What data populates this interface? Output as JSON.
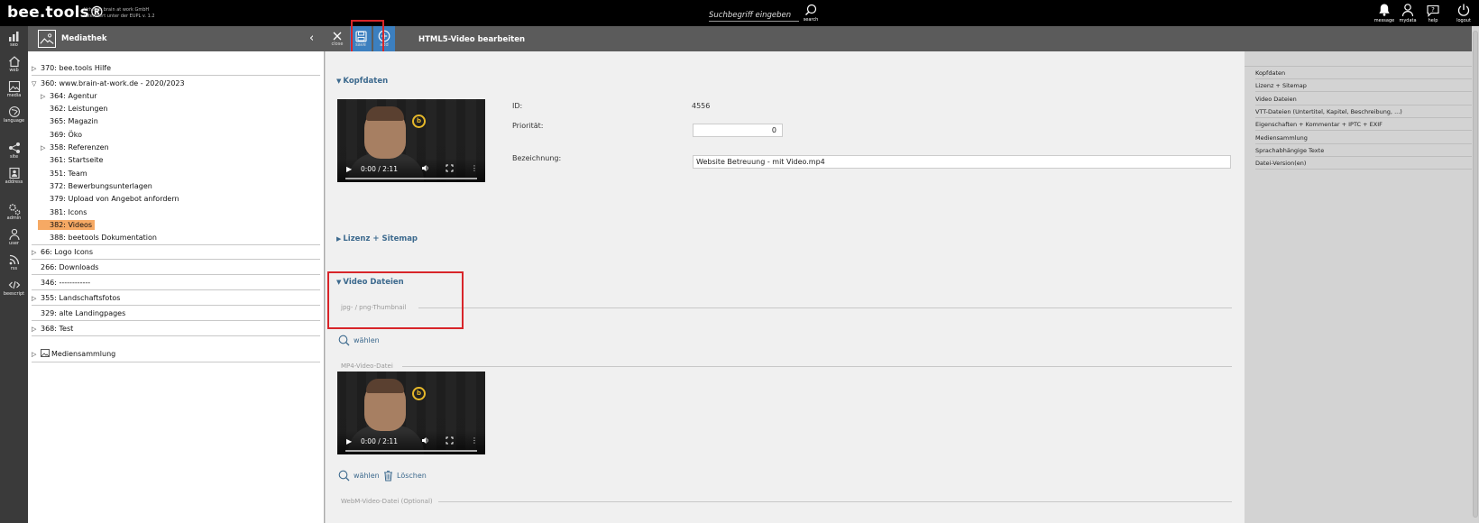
{
  "app": {
    "logo": "bee.tools®",
    "logo_sub_1": "Urheber brain at work GmbH",
    "logo_sub_2": "Lizenziert unter der EUPL v. 1.2"
  },
  "search": {
    "placeholder": "Suchbegriff eingeben",
    "button_label": "search"
  },
  "top_actions": [
    {
      "label": "message",
      "icon": "bell-icon"
    },
    {
      "label": "mydata",
      "icon": "user-icon"
    },
    {
      "label": "help",
      "icon": "help-bubble-icon"
    },
    {
      "label": "logout",
      "icon": "power-icon"
    }
  ],
  "rail": [
    {
      "label": "seo",
      "icon": "bar-chart-icon"
    },
    {
      "label": "web",
      "icon": "home-icon"
    },
    {
      "label": "media",
      "icon": "image-icon"
    },
    {
      "label": "language",
      "icon": "globe-icon"
    },
    {
      "label": "site",
      "icon": "sitemap-icon"
    },
    {
      "label": "address",
      "icon": "contact-card-icon"
    },
    {
      "label": "admin",
      "icon": "gears-icon"
    },
    {
      "label": "user",
      "icon": "users-icon"
    },
    {
      "label": "rss",
      "icon": "rss-icon"
    },
    {
      "label": "beescript",
      "icon": "code-icon"
    }
  ],
  "mediathek": {
    "title": "Mediathek",
    "tree": [
      {
        "label": "370: bee.tools Hilfe",
        "tri": "▷"
      },
      {
        "label": "360: www.brain-at-work.de - 2020/2023",
        "tri": "▽"
      },
      {
        "label": "364: Agentur",
        "tri": "▷"
      },
      {
        "label": "362: Leistungen",
        "tri": ""
      },
      {
        "label": "365: Magazin",
        "tri": ""
      },
      {
        "label": "369: Öko",
        "tri": ""
      },
      {
        "label": "358: Referenzen",
        "tri": "▷"
      },
      {
        "label": "361: Startseite",
        "tri": ""
      },
      {
        "label": "351: Team",
        "tri": ""
      },
      {
        "label": "372: Bewerbungsunterlagen",
        "tri": ""
      },
      {
        "label": "379: Upload von Angebot anfordern",
        "tri": ""
      },
      {
        "label": "381: Icons",
        "tri": ""
      },
      {
        "label": "382: Videos",
        "tri": ""
      },
      {
        "label": "388: beetools Dokumentation",
        "tri": ""
      },
      {
        "label": "66: Logo Icons",
        "tri": "▷"
      },
      {
        "label": "266: Downloads",
        "tri": ""
      },
      {
        "label": "346: ------------",
        "tri": ""
      },
      {
        "label": "355: Landschaftsfotos",
        "tri": "▷"
      },
      {
        "label": "329: alte Landingpages",
        "tri": ""
      },
      {
        "label": "368: Test",
        "tri": "▷"
      },
      {
        "label": "Mediensammlung",
        "tri": "▷"
      }
    ]
  },
  "toolbar": {
    "close_label": "close",
    "save_label": "save",
    "add_label": "add",
    "title": "HTML5-Video bearbeiten"
  },
  "kopfdaten": {
    "heading": "Kopfdaten",
    "id_label": "ID:",
    "id_value": "4556",
    "priority_label": "Priorität:",
    "priority_value": "0",
    "name_label": "Bezeichnung:",
    "name_value": "Website Betreuung - mit Video.mp4"
  },
  "video": {
    "time": "0:00 / 2:11",
    "badge": "b"
  },
  "lizenz": {
    "heading": "Lizenz + Sitemap"
  },
  "video_dateien": {
    "heading": "Video Dateien",
    "thumb_label": "jpg- / png-Thumbnail",
    "choose_label": "wählen",
    "mp4_label": "MP4-Video-Datei",
    "choose_label_2": "wählen",
    "delete_label": "Löschen",
    "webm_label": "WebM-Video-Datei (Optional)"
  },
  "right_nav": [
    "Kopfdaten",
    "Lizenz + Sitemap",
    "Video Dateien",
    "VTT-Dateien (Untertitel, Kapitel, Beschreibung, ...)",
    "Eigenschaften + Kommentar + IPTC + EXIF",
    "Mediensammlung",
    "Sprachabhängige Texte",
    "Datei-Version(en)"
  ],
  "colors": {
    "accent": "#3c7fbf",
    "selected": "#f6a964",
    "highlight": "#d8252a",
    "section": "#3d6a8e"
  }
}
